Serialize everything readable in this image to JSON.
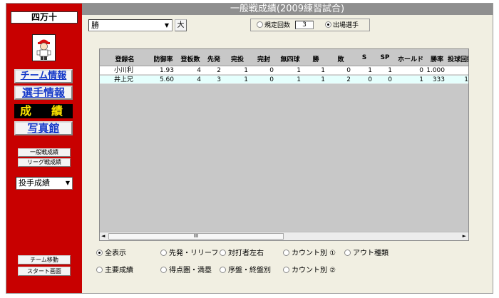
{
  "sidebar": {
    "team_name": "四万十",
    "nav": [
      "チーム情報",
      "選手情報",
      "成　績",
      "写真館"
    ],
    "sub_buttons": [
      "一般戦成績",
      "リーグ戦成績"
    ],
    "category_select": "投手成績",
    "bottom_buttons": [
      "チーム移動",
      "スタート画面"
    ]
  },
  "header": {
    "title": "一般戦成績(2009練習試合)"
  },
  "controls": {
    "combo_value": "勝",
    "dai_label": "大",
    "radio_kitei": "規定回数",
    "kitei_value": "3",
    "radio_shujo": "出場選手"
  },
  "grid": {
    "columns": [
      "登録名",
      "防御率",
      "登板数",
      "先発",
      "完投",
      "完封",
      "無四球",
      "勝",
      "敗",
      "S",
      "SP",
      "ホールド",
      "勝率",
      "投球回数"
    ],
    "rows": [
      [
        "小川利",
        "1.93",
        "4",
        "2",
        "1",
        "0",
        "1",
        "1",
        "0",
        "1",
        "1",
        "0",
        "1.000",
        ""
      ],
      [
        "井上兄",
        "5.60",
        "4",
        "3",
        "1",
        "0",
        "1",
        "1",
        "2",
        "0",
        "0",
        "1",
        "333",
        "1"
      ]
    ],
    "scroll_thumb": "III"
  },
  "bottom_radios": {
    "r1": [
      "全表示",
      "先発・リリーフ",
      "対打者左右",
      "カウント別 ①",
      "アウト種類"
    ],
    "r2": [
      "主要成績",
      "得点圏・満塁",
      "序盤・終盤別",
      "カウント別 ②"
    ]
  },
  "icons": {
    "player": "baseball-player-icon",
    "dropdown": "chevron-down-icon"
  },
  "colors": {
    "sidebar": "#c80000",
    "titlebar": "#8f8f8f",
    "nav_text": "#1438c8",
    "active_text": "#ffe600",
    "alt_row": "#e5fffd"
  }
}
